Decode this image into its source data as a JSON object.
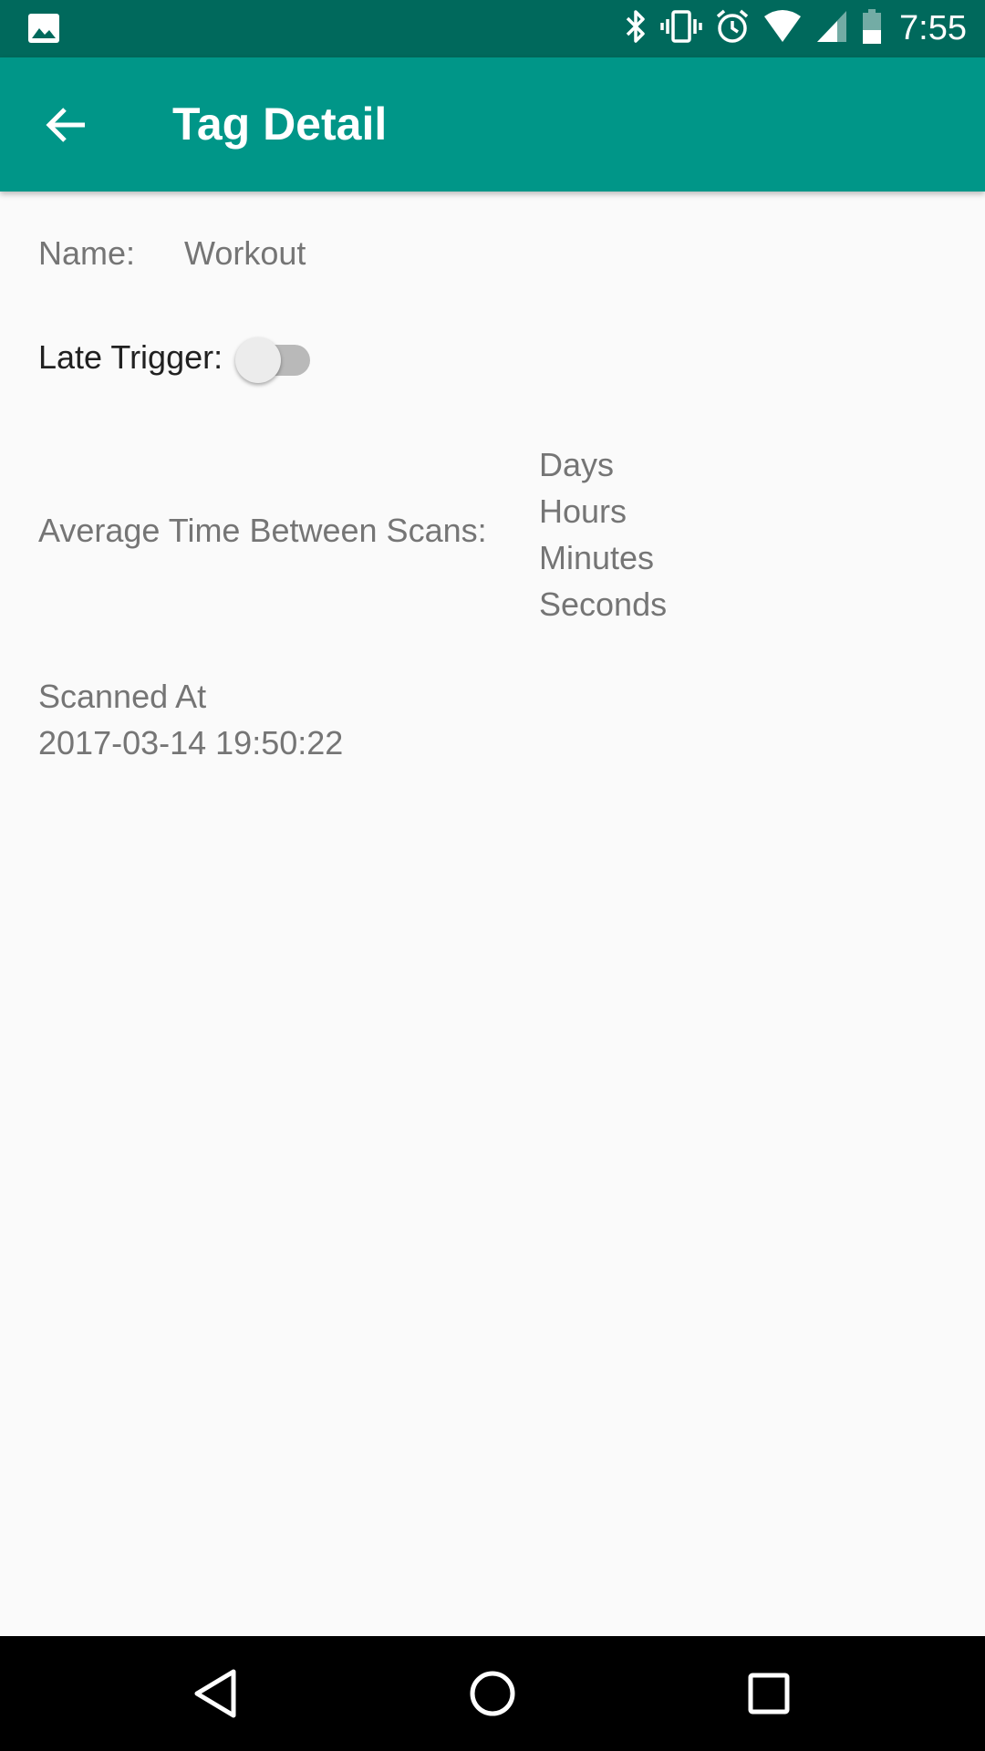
{
  "status_bar": {
    "time": "7:55",
    "icons": [
      "image-icon",
      "bluetooth-icon",
      "vibrate-icon",
      "alarm-icon",
      "wifi-icon",
      "signal-icon",
      "battery-icon"
    ]
  },
  "app_bar": {
    "title": "Tag Detail",
    "back_icon": "arrow-back-icon"
  },
  "tag": {
    "name_label": "Name:",
    "name_value": "Workout",
    "late_trigger_label": "Late Trigger:",
    "late_trigger_on": false,
    "avg_label": "Average Time Between Scans:",
    "units": [
      "Days",
      "Hours",
      "Minutes",
      "Seconds"
    ],
    "scanned_label": "Scanned At",
    "scanned_value": "2017-03-14 19:50:22"
  },
  "colors": {
    "status_bar": "#00695c",
    "app_bar": "#009688",
    "background": "#fafafa",
    "secondary_text": "#757575",
    "primary_text": "#212121"
  },
  "nav_bar": {
    "buttons": [
      "nav-back-icon",
      "nav-home-icon",
      "nav-recents-icon"
    ]
  }
}
